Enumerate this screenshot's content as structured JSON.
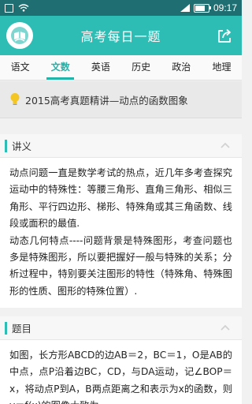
{
  "status_bar": {
    "time": "09:17"
  },
  "app_bar": {
    "title": "高考每日一题"
  },
  "tabs": [
    {
      "label": "语文",
      "active": false
    },
    {
      "label": "文数",
      "active": true
    },
    {
      "label": "英语",
      "active": false
    },
    {
      "label": "历史",
      "active": false
    },
    {
      "label": "政治",
      "active": false
    },
    {
      "label": "地理",
      "active": false
    }
  ],
  "topic": {
    "title": "2015高考真题精讲—动点的函数图象"
  },
  "sections": {
    "notes": {
      "heading": "讲义",
      "paragraphs": [
        "动点问题一直是数学考试的热点，近几年多考查探究运动中的特殊性：等腰三角形、直角三角形、相似三角形、平行四边形、梯形、特殊角或其三角函数、线段或面积的最值.",
        "动态几何特点----问题背景是特殊图形，考查问题也多是特殊图形，所以要把握好一般与特殊的关系；分析过程中，特别要关注图形的特性（特殊角、特殊图形的性质、图形的特殊位置）."
      ]
    },
    "problem": {
      "heading": "题目",
      "text": "如图，长方形ABCD的边AB＝2，BC＝1，O是AB的中点，点P沿着边BC，CD，与DA运动，记∠BOP＝x，将动点P到A，B两点距离之和表示为x的函数，则y＝f(x)的图像大致为"
    }
  },
  "colors": {
    "accent": "#2dbdb5",
    "status_bar": "#1f6f72"
  }
}
